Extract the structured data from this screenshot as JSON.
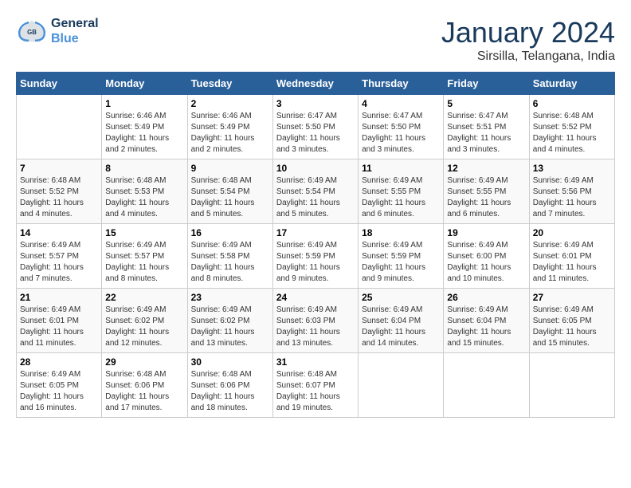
{
  "header": {
    "logo": {
      "line1": "General",
      "line2": "Blue"
    },
    "title": "January 2024",
    "location": "Sirsilla, Telangana, India"
  },
  "days_of_week": [
    "Sunday",
    "Monday",
    "Tuesday",
    "Wednesday",
    "Thursday",
    "Friday",
    "Saturday"
  ],
  "weeks": [
    [
      {
        "day": "",
        "info": ""
      },
      {
        "day": "1",
        "info": "Sunrise: 6:46 AM\nSunset: 5:49 PM\nDaylight: 11 hours\nand 2 minutes."
      },
      {
        "day": "2",
        "info": "Sunrise: 6:46 AM\nSunset: 5:49 PM\nDaylight: 11 hours\nand 2 minutes."
      },
      {
        "day": "3",
        "info": "Sunrise: 6:47 AM\nSunset: 5:50 PM\nDaylight: 11 hours\nand 3 minutes."
      },
      {
        "day": "4",
        "info": "Sunrise: 6:47 AM\nSunset: 5:50 PM\nDaylight: 11 hours\nand 3 minutes."
      },
      {
        "day": "5",
        "info": "Sunrise: 6:47 AM\nSunset: 5:51 PM\nDaylight: 11 hours\nand 3 minutes."
      },
      {
        "day": "6",
        "info": "Sunrise: 6:48 AM\nSunset: 5:52 PM\nDaylight: 11 hours\nand 4 minutes."
      }
    ],
    [
      {
        "day": "7",
        "info": "Sunrise: 6:48 AM\nSunset: 5:52 PM\nDaylight: 11 hours\nand 4 minutes."
      },
      {
        "day": "8",
        "info": "Sunrise: 6:48 AM\nSunset: 5:53 PM\nDaylight: 11 hours\nand 4 minutes."
      },
      {
        "day": "9",
        "info": "Sunrise: 6:48 AM\nSunset: 5:54 PM\nDaylight: 11 hours\nand 5 minutes."
      },
      {
        "day": "10",
        "info": "Sunrise: 6:49 AM\nSunset: 5:54 PM\nDaylight: 11 hours\nand 5 minutes."
      },
      {
        "day": "11",
        "info": "Sunrise: 6:49 AM\nSunset: 5:55 PM\nDaylight: 11 hours\nand 6 minutes."
      },
      {
        "day": "12",
        "info": "Sunrise: 6:49 AM\nSunset: 5:55 PM\nDaylight: 11 hours\nand 6 minutes."
      },
      {
        "day": "13",
        "info": "Sunrise: 6:49 AM\nSunset: 5:56 PM\nDaylight: 11 hours\nand 7 minutes."
      }
    ],
    [
      {
        "day": "14",
        "info": "Sunrise: 6:49 AM\nSunset: 5:57 PM\nDaylight: 11 hours\nand 7 minutes."
      },
      {
        "day": "15",
        "info": "Sunrise: 6:49 AM\nSunset: 5:57 PM\nDaylight: 11 hours\nand 8 minutes."
      },
      {
        "day": "16",
        "info": "Sunrise: 6:49 AM\nSunset: 5:58 PM\nDaylight: 11 hours\nand 8 minutes."
      },
      {
        "day": "17",
        "info": "Sunrise: 6:49 AM\nSunset: 5:59 PM\nDaylight: 11 hours\nand 9 minutes."
      },
      {
        "day": "18",
        "info": "Sunrise: 6:49 AM\nSunset: 5:59 PM\nDaylight: 11 hours\nand 9 minutes."
      },
      {
        "day": "19",
        "info": "Sunrise: 6:49 AM\nSunset: 6:00 PM\nDaylight: 11 hours\nand 10 minutes."
      },
      {
        "day": "20",
        "info": "Sunrise: 6:49 AM\nSunset: 6:01 PM\nDaylight: 11 hours\nand 11 minutes."
      }
    ],
    [
      {
        "day": "21",
        "info": "Sunrise: 6:49 AM\nSunset: 6:01 PM\nDaylight: 11 hours\nand 11 minutes."
      },
      {
        "day": "22",
        "info": "Sunrise: 6:49 AM\nSunset: 6:02 PM\nDaylight: 11 hours\nand 12 minutes."
      },
      {
        "day": "23",
        "info": "Sunrise: 6:49 AM\nSunset: 6:02 PM\nDaylight: 11 hours\nand 13 minutes."
      },
      {
        "day": "24",
        "info": "Sunrise: 6:49 AM\nSunset: 6:03 PM\nDaylight: 11 hours\nand 13 minutes."
      },
      {
        "day": "25",
        "info": "Sunrise: 6:49 AM\nSunset: 6:04 PM\nDaylight: 11 hours\nand 14 minutes."
      },
      {
        "day": "26",
        "info": "Sunrise: 6:49 AM\nSunset: 6:04 PM\nDaylight: 11 hours\nand 15 minutes."
      },
      {
        "day": "27",
        "info": "Sunrise: 6:49 AM\nSunset: 6:05 PM\nDaylight: 11 hours\nand 15 minutes."
      }
    ],
    [
      {
        "day": "28",
        "info": "Sunrise: 6:49 AM\nSunset: 6:05 PM\nDaylight: 11 hours\nand 16 minutes."
      },
      {
        "day": "29",
        "info": "Sunrise: 6:48 AM\nSunset: 6:06 PM\nDaylight: 11 hours\nand 17 minutes."
      },
      {
        "day": "30",
        "info": "Sunrise: 6:48 AM\nSunset: 6:06 PM\nDaylight: 11 hours\nand 18 minutes."
      },
      {
        "day": "31",
        "info": "Sunrise: 6:48 AM\nSunset: 6:07 PM\nDaylight: 11 hours\nand 19 minutes."
      },
      {
        "day": "",
        "info": ""
      },
      {
        "day": "",
        "info": ""
      },
      {
        "day": "",
        "info": ""
      }
    ]
  ]
}
